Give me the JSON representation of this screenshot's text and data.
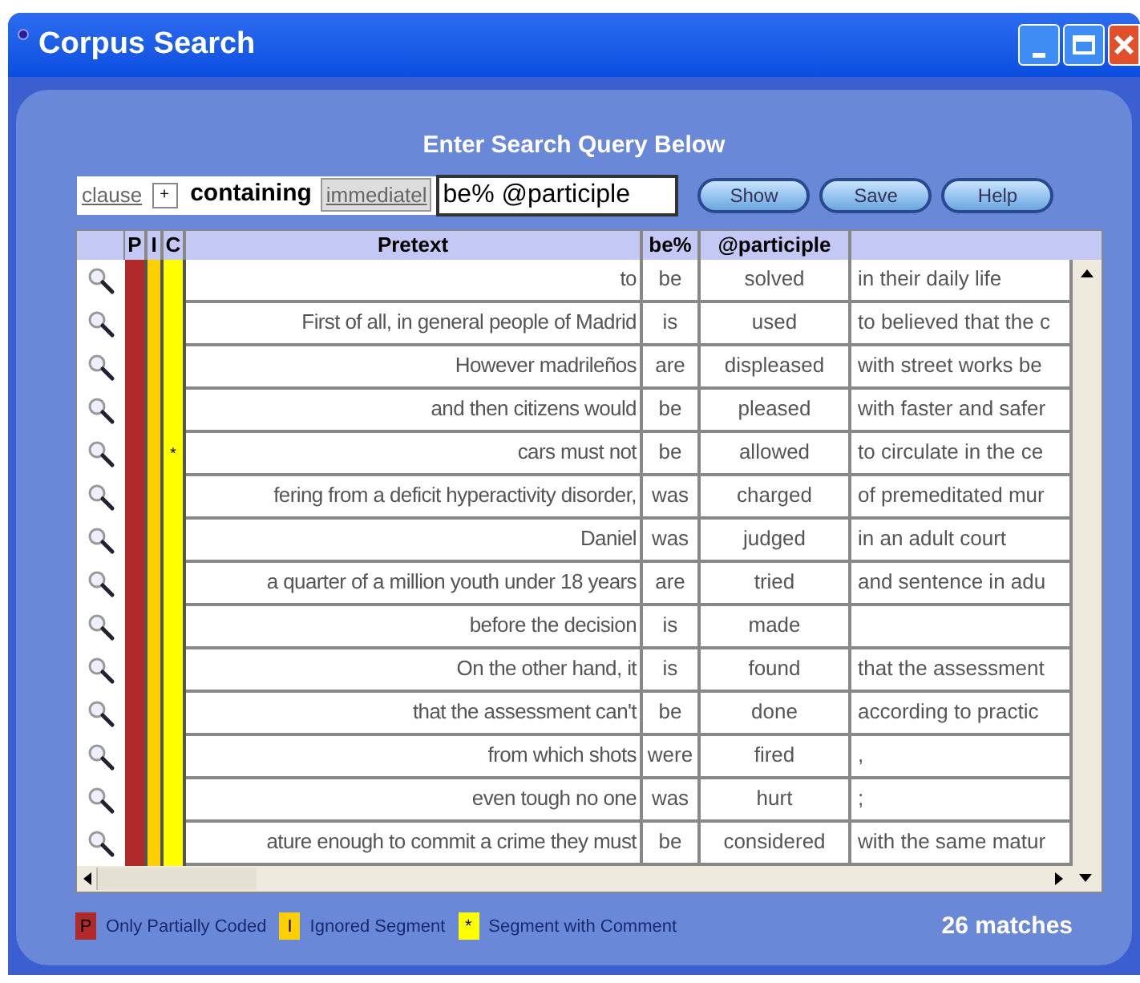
{
  "window": {
    "title": "Corpus Search"
  },
  "query": {
    "heading": "Enter Search Query Below",
    "scope": "clause",
    "add": "+",
    "connector": "containing",
    "modifier": "immediatel",
    "value": "be% @participle",
    "buttons": [
      "Show",
      "Save",
      "Help"
    ]
  },
  "table": {
    "columns": [
      "P",
      "I",
      "C",
      "Pretext",
      "be%",
      "@participle"
    ],
    "rows": [
      {
        "pretext": "to",
        "verb": "be",
        "participle": "solved",
        "posttext": "in their daily life"
      },
      {
        "pretext": "First of all, in general people of Madrid",
        "verb": "is",
        "participle": "used",
        "posttext": "to believed that the c"
      },
      {
        "pretext": "However madrileños",
        "verb": "are",
        "participle": "displeased",
        "posttext": "with street works be"
      },
      {
        "pretext": "and then citizens would",
        "verb": "be",
        "participle": "pleased",
        "posttext": "with faster and safer"
      },
      {
        "pretext": "cars must not",
        "verb": "be",
        "participle": "allowed",
        "posttext": "to circulate in the ce",
        "comment": "*"
      },
      {
        "pretext": "fering from a deficit hyperactivity disorder,",
        "verb": "was",
        "participle": "charged",
        "posttext": "of premeditated mur"
      },
      {
        "pretext": "Daniel",
        "verb": "was",
        "participle": "judged",
        "posttext": "in an adult court"
      },
      {
        "pretext": "a quarter of a million youth under 18 years",
        "verb": "are",
        "participle": "tried",
        "posttext": "and sentence in adu"
      },
      {
        "pretext": "before the decision",
        "verb": "is",
        "participle": "made"
      },
      {
        "pretext": "On the other hand, it",
        "verb": "is",
        "participle": "found",
        "posttext": "that the assessment"
      },
      {
        "pretext": "that the assessment can't",
        "verb": "be",
        "participle": "done",
        "posttext": "according to practic"
      },
      {
        "pretext": "from which shots",
        "verb": "were",
        "participle": "fired",
        "posttext": ","
      },
      {
        "pretext": "even tough no one",
        "verb": "was",
        "participle": "hurt",
        "posttext": ";"
      },
      {
        "pretext": "ature enough to commit a crime they must",
        "verb": "be",
        "participle": "considered",
        "posttext": "with the same matur"
      }
    ]
  },
  "legend": [
    {
      "kind": "partial",
      "mark": "P",
      "label": "Only Partially Coded"
    },
    {
      "kind": "ignored",
      "mark": "I",
      "label": "Ignored Segment"
    },
    {
      "kind": "comment",
      "mark": "*",
      "label": "Segment with Comment"
    }
  ],
  "status": "26 matches"
}
